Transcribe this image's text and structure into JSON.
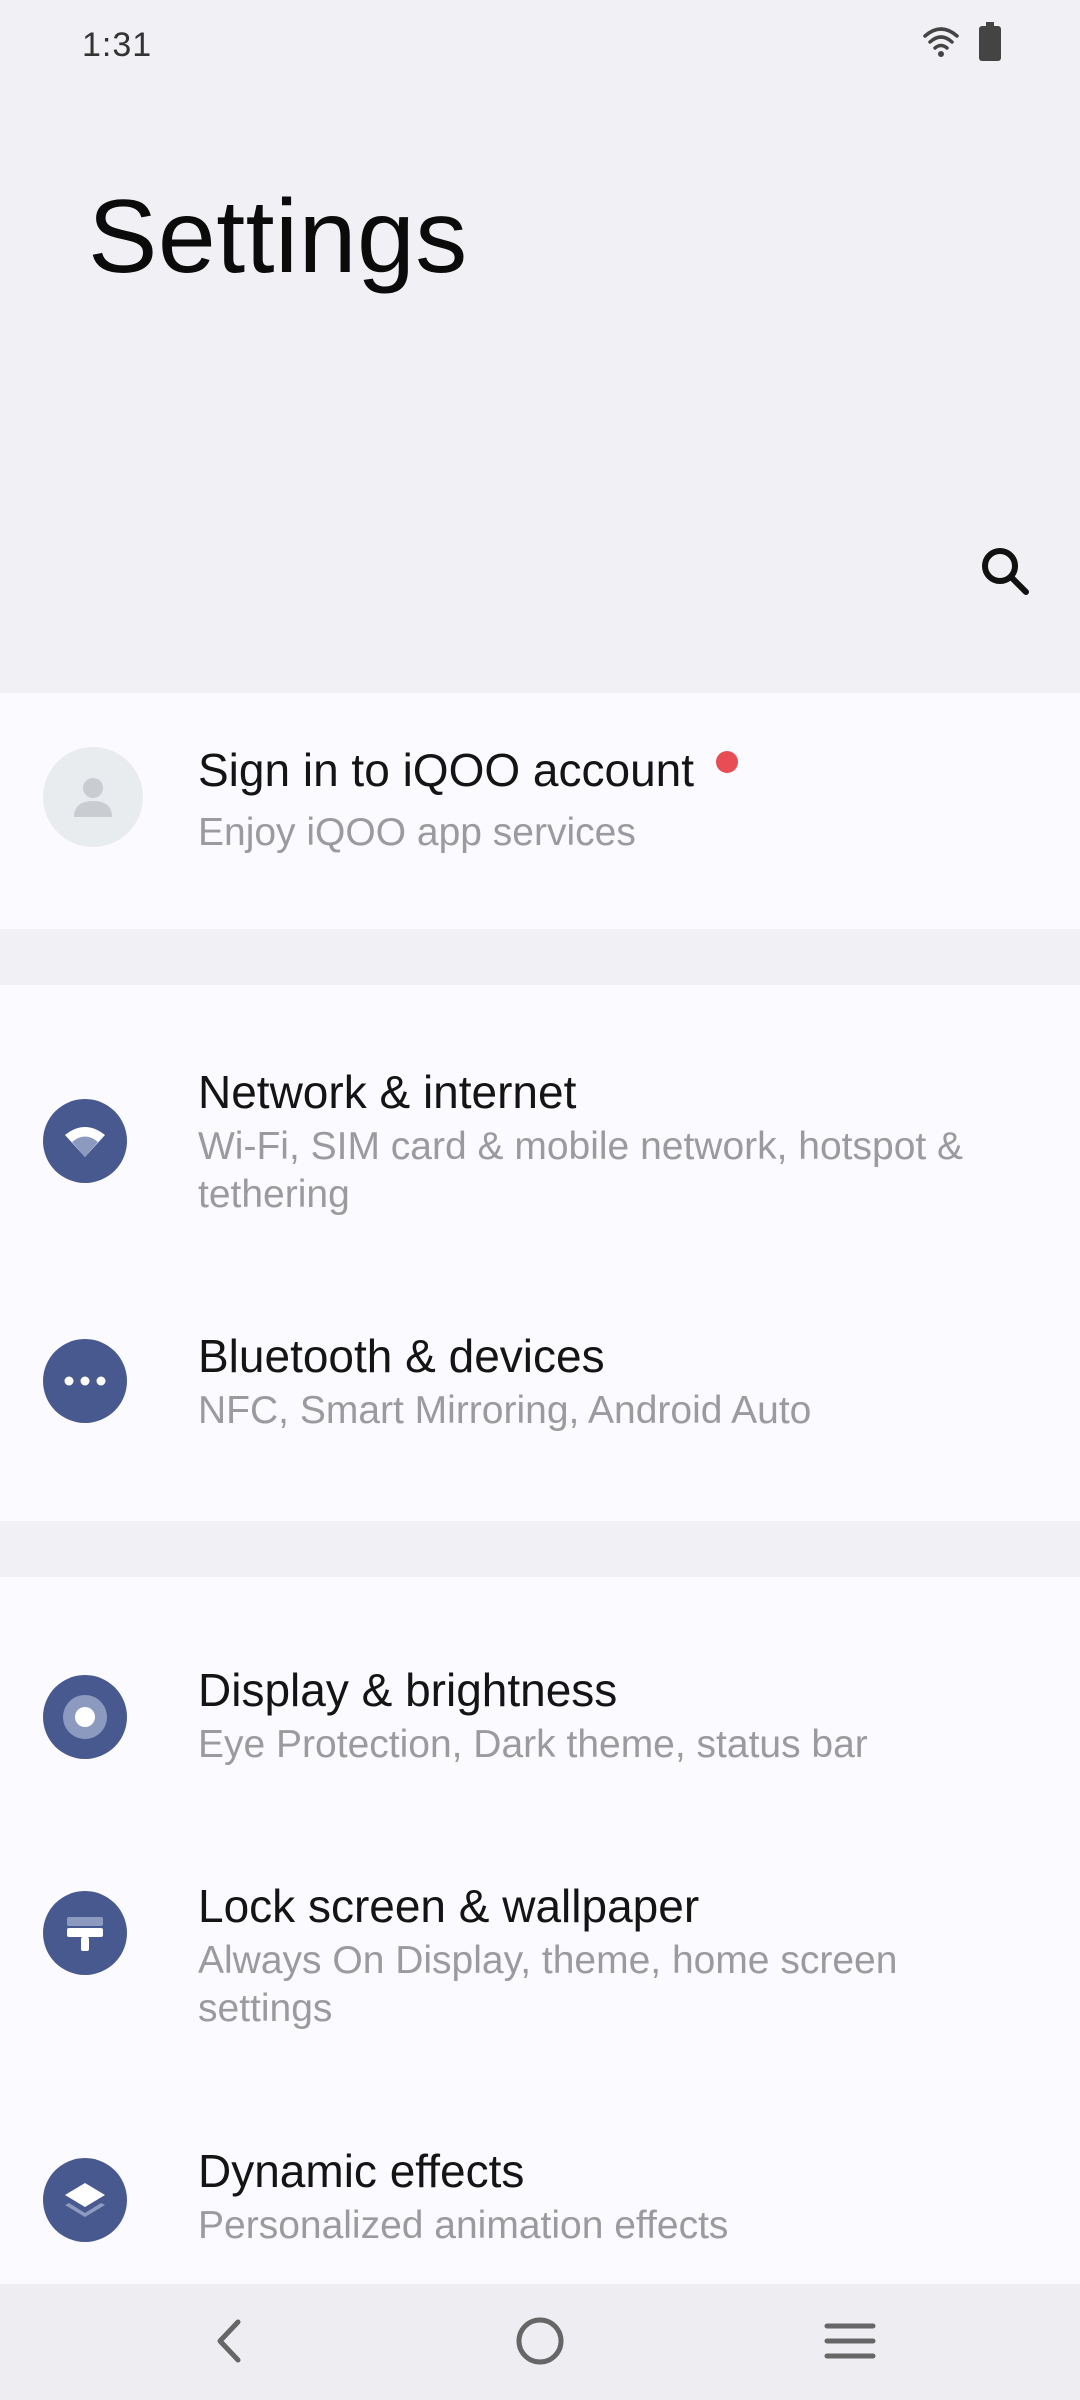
{
  "status_bar": {
    "time": "1:31",
    "icons": [
      "wifi-icon",
      "battery-icon"
    ]
  },
  "header": {
    "title": "Settings",
    "search_icon": "search-icon"
  },
  "account": {
    "title": "Sign in to iQOO account",
    "subtitle": "Enjoy iQOO app services",
    "notification_dot_color": "#e84c55"
  },
  "items": [
    {
      "title": "Network & internet",
      "subtitle": "Wi-Fi, SIM card & mobile network, hotspot & tethering",
      "icon": "wifi-icon"
    },
    {
      "title": "Bluetooth & devices",
      "subtitle": "NFC, Smart Mirroring, Android Auto",
      "icon": "more-dots-icon"
    },
    {
      "title": "Display & brightness",
      "subtitle": "Eye Protection, Dark theme, status bar",
      "icon": "brightness-icon"
    },
    {
      "title": "Lock screen & wallpaper",
      "subtitle": "Always On Display, theme, home screen settings",
      "icon": "wallpaper-icon"
    },
    {
      "title": "Dynamic effects",
      "subtitle": "Personalized animation effects",
      "icon": "layers-icon"
    }
  ],
  "nav": [
    "back-icon",
    "home-icon",
    "menu-icon"
  ],
  "colors": {
    "icon_bg": "#48598f",
    "page_bg": "#f1f0f5",
    "card_bg": "#fbfafe",
    "subtitle": "#9b9b9f"
  }
}
